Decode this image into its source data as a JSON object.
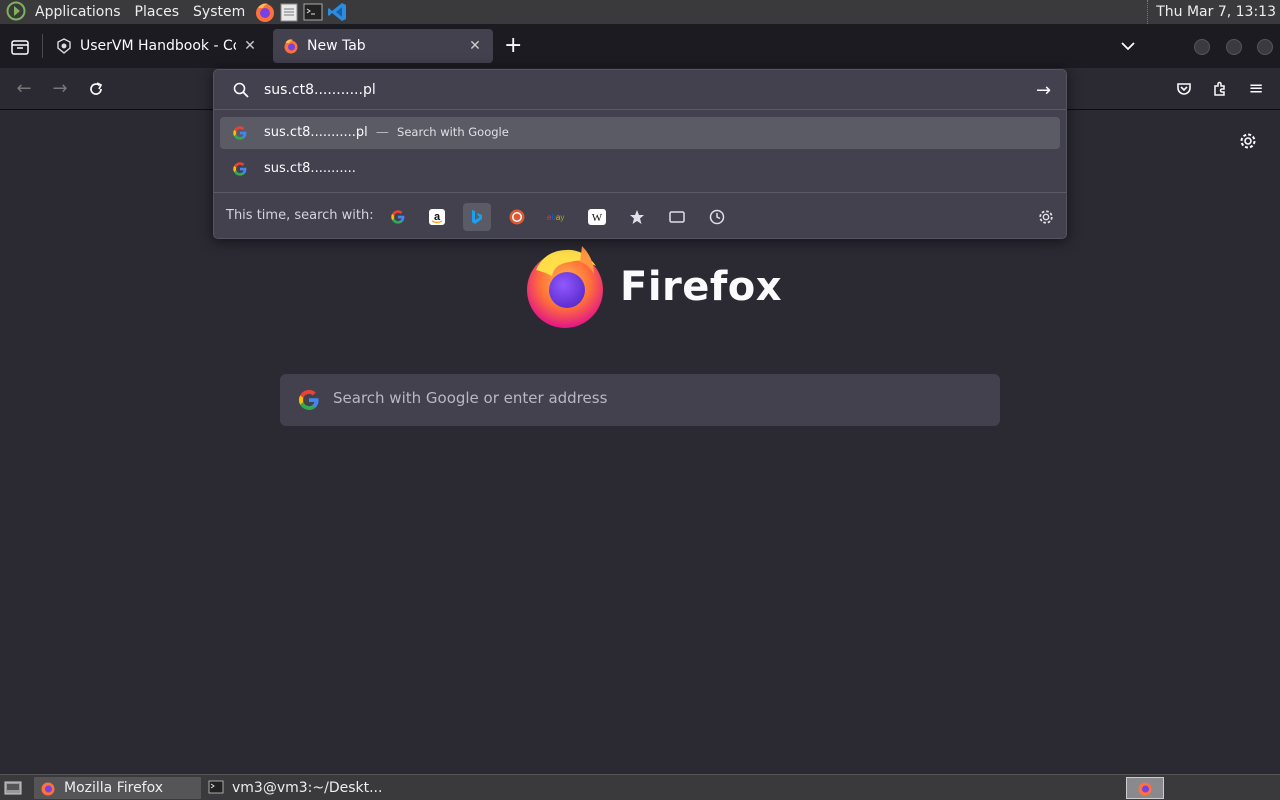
{
  "top_panel": {
    "menus": [
      "Applications",
      "Places",
      "System"
    ],
    "clock": "Thu Mar  7, 13:13"
  },
  "tabs": [
    {
      "title": "UserVM Handbook - Compu",
      "active": false
    },
    {
      "title": "New Tab",
      "active": true
    }
  ],
  "urlbar": {
    "value": "sus.ct8...........pl",
    "results": [
      {
        "text": "sus.ct8...........pl",
        "separator": "—",
        "action": "Search with Google",
        "selected": true
      },
      {
        "text": "sus.ct8...........",
        "separator": "",
        "action": "",
        "selected": false
      }
    ],
    "oneoff_label": "This time, search with:",
    "engines": [
      "google-icon",
      "amazon-icon",
      "bing-icon",
      "duckduckgo-icon",
      "ebay-icon",
      "wikipedia-icon",
      "bookmarks-icon",
      "tabs-icon",
      "history-icon"
    ]
  },
  "newtab": {
    "brand": "Firefox",
    "search_placeholder": "Search with Google or enter address"
  },
  "taskbar": {
    "items": [
      {
        "label": "Mozilla Firefox",
        "active": true
      },
      {
        "label": "vm3@vm3:~/Deskt...",
        "active": false
      }
    ]
  },
  "colors": {
    "accent_selected_row": "#5b5b66",
    "firefox_orange": "#ff7139",
    "firefox_purple": "#7542e5"
  }
}
